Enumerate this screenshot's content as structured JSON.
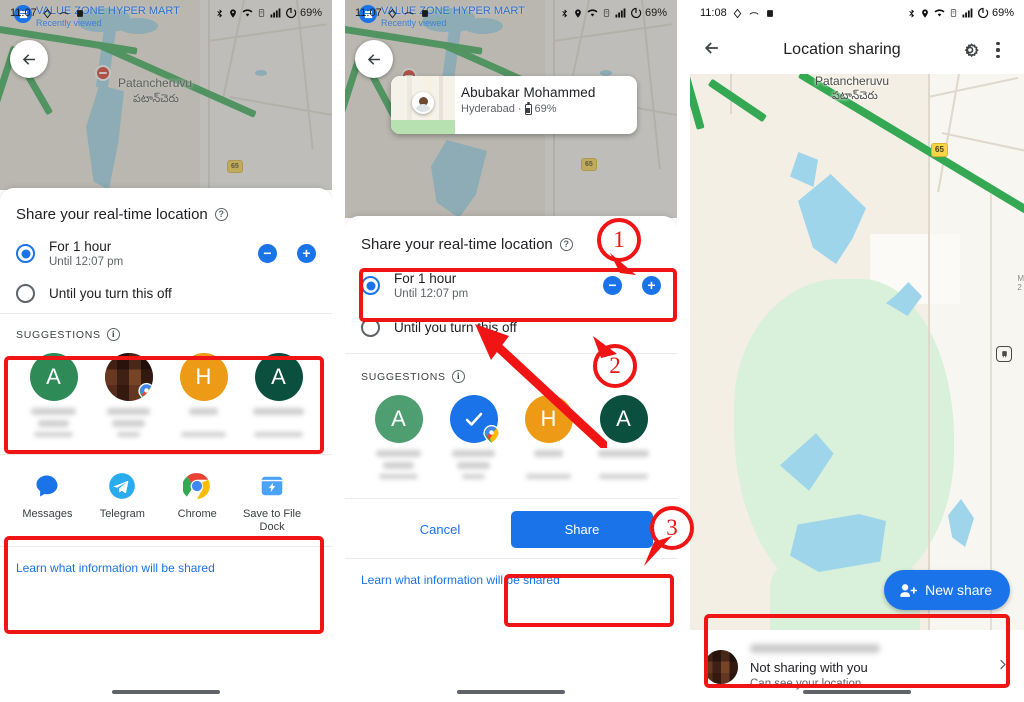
{
  "statusbar": {
    "time_panel1": "11:07",
    "time_panel2": "11:07",
    "time_panel3": "11:08",
    "battery": "69%"
  },
  "map": {
    "place_name_en": "Patancheruvu",
    "place_name_te": "పటాన్‌చెరు",
    "highway_shield": "65",
    "mart_name": "VALUE ZONE HYPER MART",
    "mart_sub": "Recently viewed"
  },
  "callout": {
    "name": "Abubakar Mohammed",
    "city": "Hyderabad",
    "separator": "·",
    "battery": "69%"
  },
  "sheet": {
    "title": "Share your real-time location",
    "help_icon": "help-icon",
    "options": [
      {
        "label": "For 1 hour",
        "sub": "Until 12:07 pm",
        "selected": true
      },
      {
        "label": "Until you turn this off",
        "sub": "",
        "selected": false
      }
    ],
    "stepper": {
      "decrease": "−",
      "increase": "+"
    },
    "suggestions_label": "SUGGESTIONS",
    "suggestions": [
      {
        "initial": "A",
        "color": "#2e8b57",
        "type": "initial",
        "selected": false
      },
      {
        "initial": "",
        "color": "#6a4a3c",
        "type": "photo",
        "selected": false,
        "has_maps_badge": true
      },
      {
        "initial": "H",
        "color": "#ed9b16",
        "type": "initial",
        "selected": false
      },
      {
        "initial": "A",
        "color": "#0b4f3f",
        "type": "initial",
        "selected": false
      }
    ],
    "suggestions_selected": [
      {
        "initial": "A",
        "color": "#4e9e72",
        "type": "initial",
        "selected": false
      },
      {
        "initial": "",
        "color": "#1a73e8",
        "type": "check",
        "selected": true,
        "has_maps_badge": true
      },
      {
        "initial": "H",
        "color": "#ed9b16",
        "type": "initial",
        "selected": false
      },
      {
        "initial": "A",
        "color": "#0b4f3f",
        "type": "initial",
        "selected": false
      }
    ],
    "apps": [
      {
        "label": "Messages",
        "icon": "messages-icon"
      },
      {
        "label": "Telegram",
        "icon": "telegram-icon"
      },
      {
        "label": "Chrome",
        "icon": "chrome-icon"
      },
      {
        "label": "Save to File Dock",
        "icon": "save-to-file-dock-icon"
      }
    ],
    "cancel_label": "Cancel",
    "share_label": "Share",
    "learn_link": "Learn what information will be shared"
  },
  "location_sharing": {
    "title": "Location sharing",
    "back_icon": "back-arrow-icon",
    "settings_icon": "gear-icon",
    "overflow_icon": "more-vert-icon",
    "new_share_label": "New share",
    "new_share_icon": "person-add-icon",
    "item": {
      "name_redacted": "",
      "line1": "Not sharing with you",
      "line2": "Can see your location",
      "chevron": "chevron-right-icon"
    }
  },
  "annotations": {
    "markers": [
      "1",
      "2",
      "3"
    ],
    "color": "#f11414"
  },
  "colors": {
    "accent_blue": "#1a73e8",
    "annotation_red": "#f11414",
    "highway_green": "#34a853",
    "water_blue": "#9fd5ea"
  }
}
